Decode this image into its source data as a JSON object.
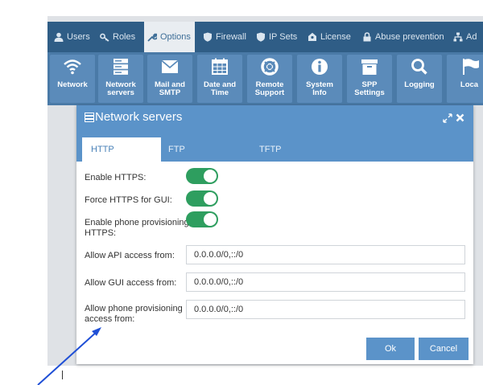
{
  "nav": {
    "items": [
      {
        "label": "Users"
      },
      {
        "label": "Roles"
      },
      {
        "label": "Options"
      },
      {
        "label": "Firewall"
      },
      {
        "label": "IP Sets"
      },
      {
        "label": "License"
      },
      {
        "label": "Abuse prevention"
      },
      {
        "label": "Ad"
      }
    ]
  },
  "toolbar": {
    "items": [
      {
        "l1": "Network",
        "l2": ""
      },
      {
        "l1": "Network",
        "l2": "servers"
      },
      {
        "l1": "Mail and",
        "l2": "SMTP"
      },
      {
        "l1": "Date and",
        "l2": "Time"
      },
      {
        "l1": "Remote",
        "l2": "Support"
      },
      {
        "l1": "System",
        "l2": "Info"
      },
      {
        "l1": "SPP",
        "l2": "Settings"
      },
      {
        "l1": "Logging",
        "l2": ""
      },
      {
        "l1": "Loca",
        "l2": ""
      }
    ]
  },
  "modal": {
    "title": "Network servers",
    "tabs": [
      {
        "label": "HTTP",
        "active": true
      },
      {
        "label": "FTP",
        "active": false
      },
      {
        "label": "TFTP",
        "active": false
      }
    ],
    "fields": {
      "enable_https": {
        "label": "Enable HTTPS:",
        "on": true
      },
      "force_https": {
        "label": "Force HTTPS for GUI:",
        "on": true
      },
      "phone_prov_https": {
        "label_1": "Enable phone provisioning",
        "label_2": "HTTPS:",
        "on": true
      },
      "api_access": {
        "label": "Allow API access from:",
        "value": "0.0.0.0/0,::/0"
      },
      "gui_access": {
        "label": "Allow GUI access from:",
        "value": "0.0.0.0/0,::/0"
      },
      "phone_access": {
        "label_1": "Allow phone provisioning",
        "label_2": "access from:",
        "value": "0.0.0.0/0,::/0"
      }
    },
    "ok_label": "Ok",
    "cancel_label": "Cancel"
  },
  "colors": {
    "nav_bg": "#2f5d86",
    "toolbar_bg": "#4a7aa7",
    "accent": "#5b93c9",
    "toggle_on": "#2e9e5f",
    "arrow": "#1f4fd6"
  }
}
